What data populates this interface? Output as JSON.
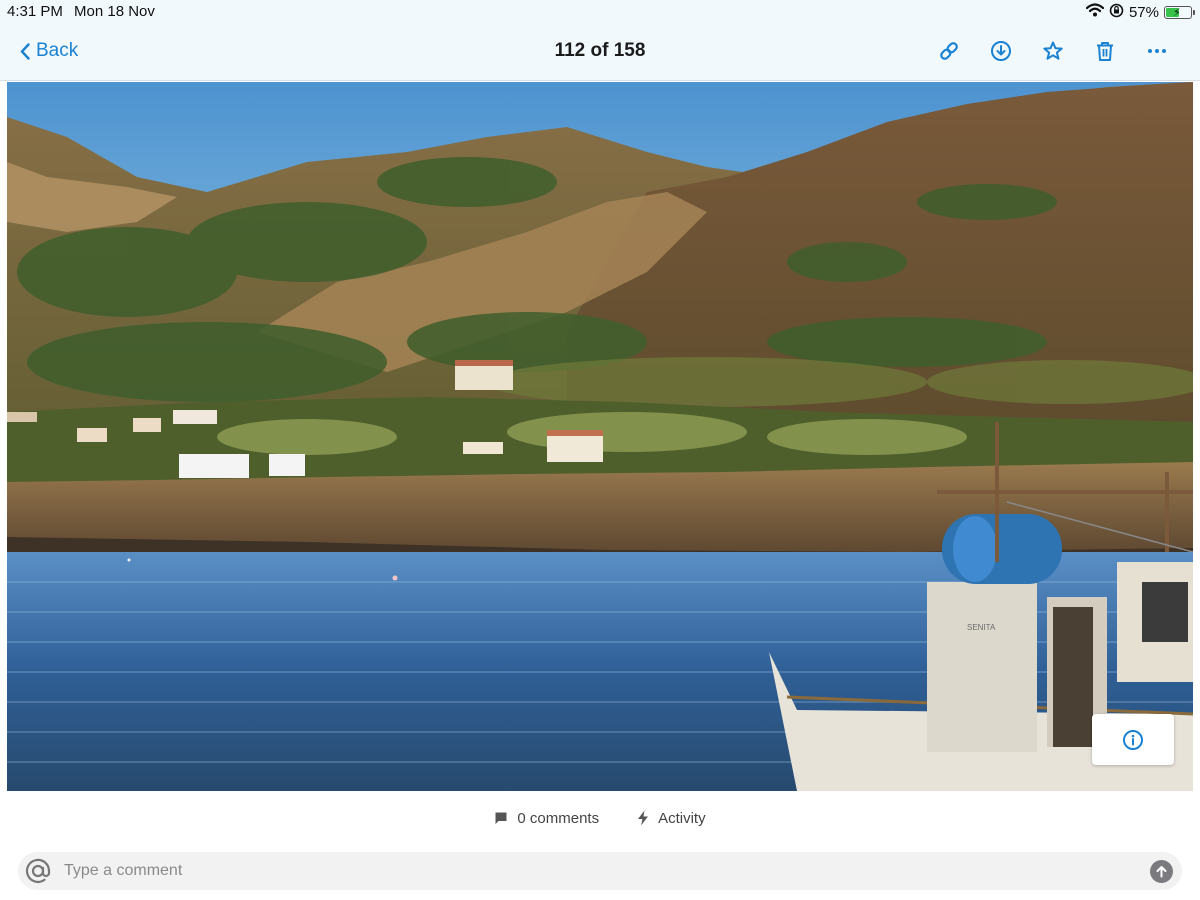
{
  "status": {
    "time": "4:31 PM",
    "date": "Mon 18 Nov",
    "battery_percent": "57%",
    "battery_level": 0.57,
    "icons": [
      "wifi-icon",
      "orientation-lock-icon",
      "battery-charging-icon"
    ]
  },
  "nav": {
    "back_label": "Back",
    "title": "112 of 158",
    "actions": [
      "link-icon",
      "download-icon",
      "star-icon",
      "trash-icon",
      "more-icon"
    ]
  },
  "photo": {
    "boat_name": "SENITA"
  },
  "footer": {
    "comments_label": "0 comments",
    "activity_label": "Activity",
    "comment_placeholder": "Type a comment"
  },
  "colors": {
    "accent": "#1a82d2",
    "bar_background": "#f2f9fd",
    "battery_green": "#37c24a"
  }
}
